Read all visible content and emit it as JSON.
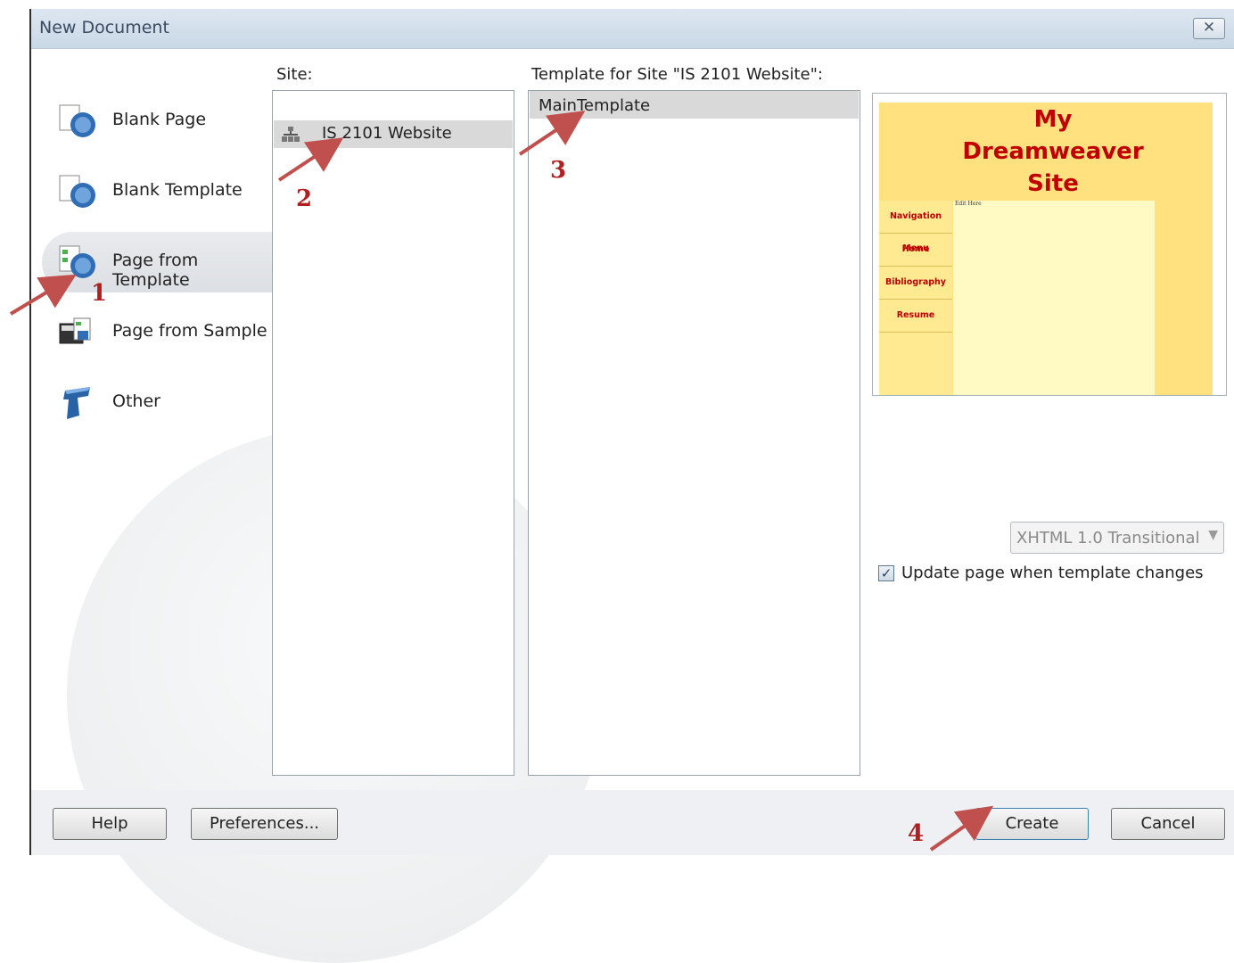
{
  "window": {
    "title": "New Document",
    "close_glyph": "✕",
    "close_icon": "close-icon"
  },
  "categories": [
    {
      "label": "Blank Page",
      "icon": "blank-page-icon",
      "selected": false
    },
    {
      "label": "Blank Template",
      "icon": "blank-template-icon",
      "selected": false
    },
    {
      "label": "Page from Template",
      "icon": "page-from-template-icon",
      "selected": true
    },
    {
      "label": "Page from Sample",
      "icon": "page-from-sample-icon",
      "selected": false
    },
    {
      "label": "Other",
      "icon": "other-icon",
      "selected": false
    }
  ],
  "site": {
    "header": "Site:",
    "items": [
      {
        "label": "IS 2101 Website",
        "icon": "site-tree-icon",
        "selected": true
      }
    ]
  },
  "templates": {
    "header": "Template for Site \"IS 2101 Website\":",
    "items": [
      {
        "label": "MainTemplate",
        "selected": true
      }
    ]
  },
  "preview": {
    "title_lines": [
      "My",
      "Dreamweaver",
      "Site"
    ],
    "nav_items": [
      "Navigation Menu",
      "Home",
      "Bibliography",
      "Resume"
    ],
    "content_text": "Edit Here"
  },
  "doctype": {
    "value": "XHTML 1.0 Transitional",
    "enabled": false
  },
  "update_checkbox": {
    "label": "Update page when template changes",
    "checked": true,
    "check_glyph": "✓"
  },
  "buttons": {
    "help": "Help",
    "preferences": "Preferences...",
    "create": "Create",
    "cancel": "Cancel"
  },
  "annotations": {
    "step1": "1",
    "step2": "2",
    "step3": "3",
    "step4": "4",
    "arrow_color": "#c0504d"
  },
  "colors": {
    "accent_red": "#c00000",
    "preview_yellow": "#ffe17f"
  }
}
